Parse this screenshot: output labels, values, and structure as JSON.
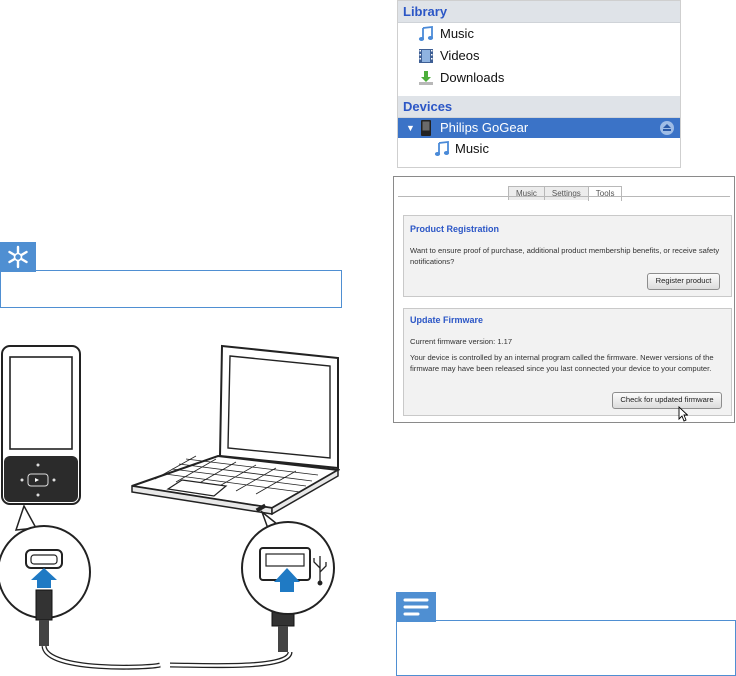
{
  "library": {
    "header": "Library",
    "items": [
      {
        "label": "Music",
        "icon": "music-note-icon"
      },
      {
        "label": "Videos",
        "icon": "film-icon"
      },
      {
        "label": "Downloads",
        "icon": "download-icon"
      }
    ]
  },
  "devices": {
    "header": "Devices",
    "device": {
      "label": "Philips GoGear",
      "icon": "device-icon"
    },
    "children": [
      {
        "label": "Music",
        "icon": "music-note-icon"
      }
    ]
  },
  "tools_panel": {
    "tabs": [
      {
        "label": "Music",
        "active": false
      },
      {
        "label": "Settings",
        "active": false
      },
      {
        "label": "Tools",
        "active": true
      }
    ],
    "product_registration": {
      "title": "Product Registration",
      "text": "Want to ensure proof of purchase, additional product membership benefits, or receive safety notifications?",
      "button": "Register product"
    },
    "update_firmware": {
      "title": "Update Firmware",
      "version_text": "Current firmware version:  1.17",
      "text": "Your device is controlled by an internal program called the firmware. Newer versions of the firmware may have been released since you last connected your device to your computer.",
      "button": "Check for updated firmware"
    }
  },
  "colors": {
    "accent_blue": "#4f8fd2",
    "header_text": "#2b56c6",
    "selection": "#3b73c7"
  },
  "illustration": {
    "icons": [
      "player-device",
      "laptop",
      "usb-cable",
      "usb-symbol-icon"
    ]
  }
}
